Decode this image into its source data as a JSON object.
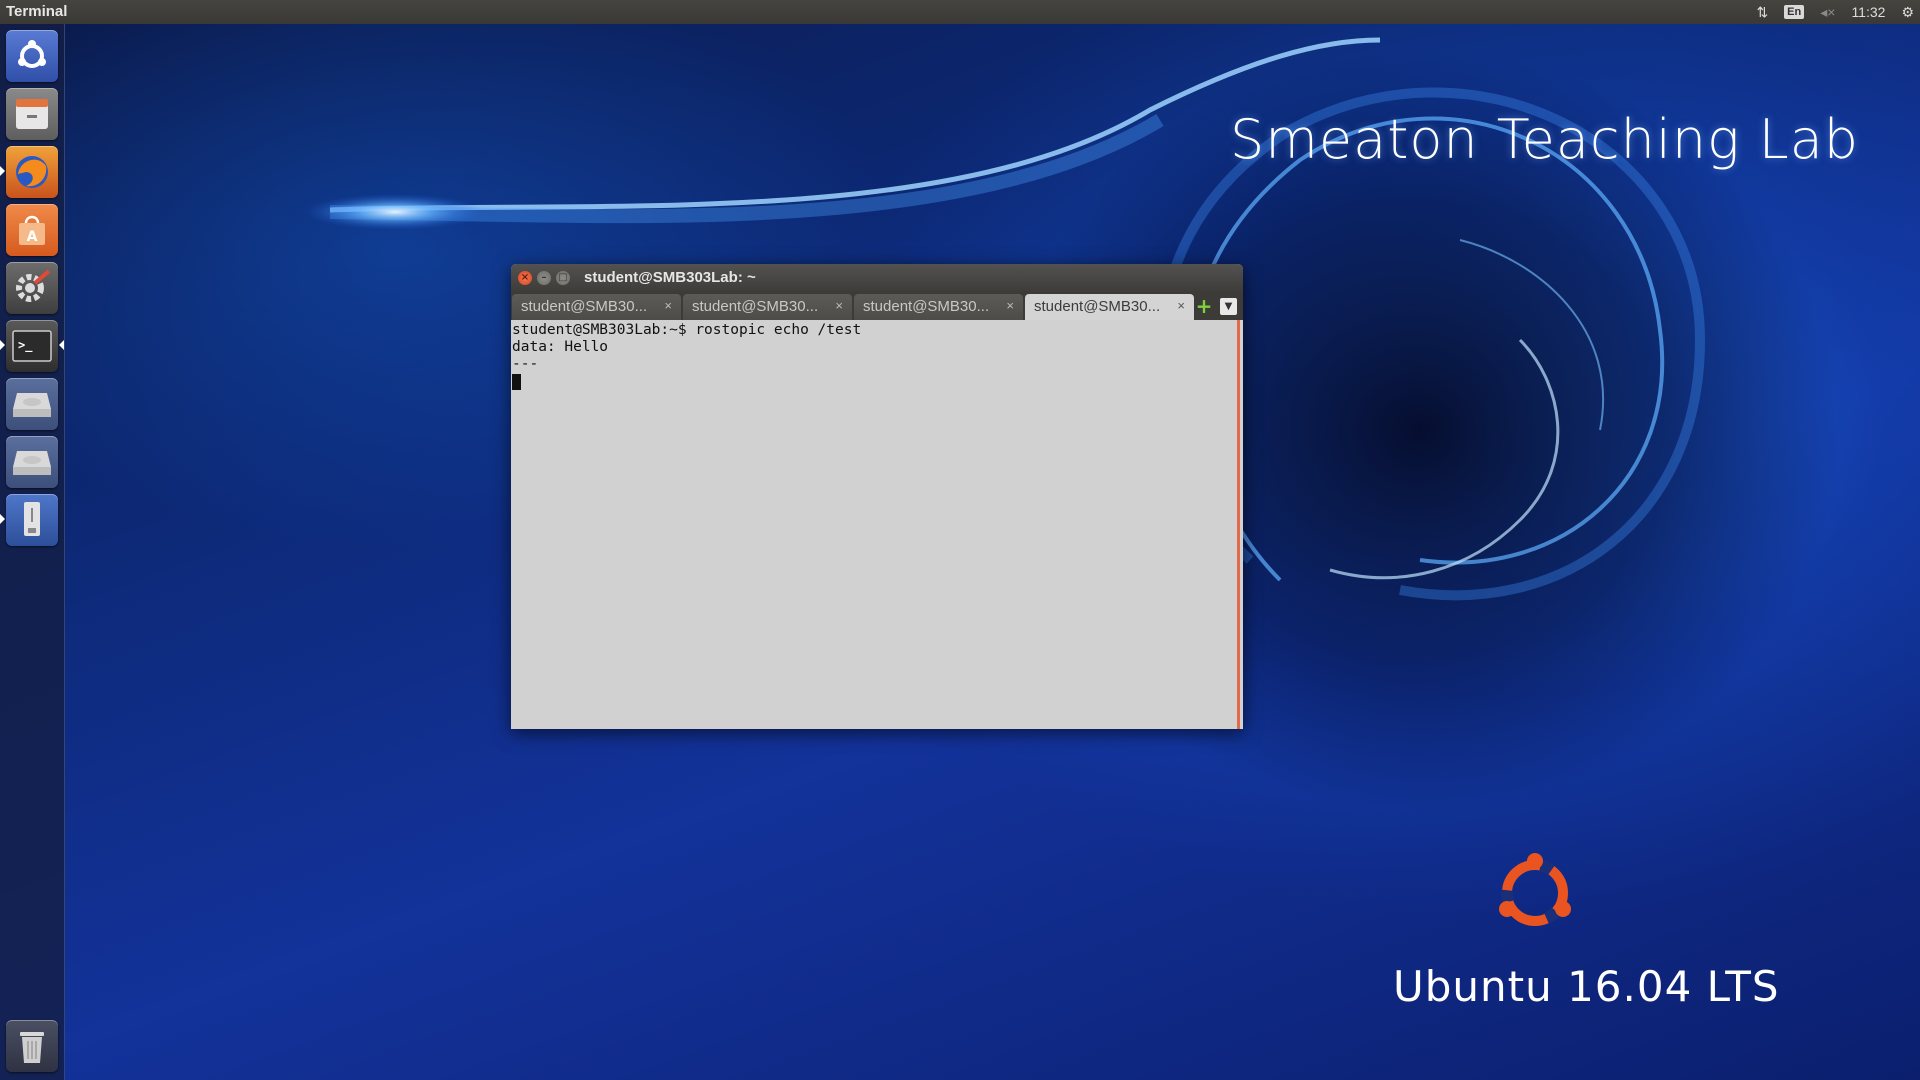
{
  "top_panel": {
    "app_title": "Terminal",
    "keyboard_layout": "En",
    "clock": "11:32",
    "icons": [
      "network-icon",
      "keyboard-icon",
      "volume-muted-icon",
      "settings-gear-icon"
    ]
  },
  "launcher": {
    "items": [
      {
        "name": "dash-home",
        "icon": "ubuntu-dash-icon"
      },
      {
        "name": "files",
        "icon": "file-cabinet-icon"
      },
      {
        "name": "firefox",
        "icon": "firefox-icon"
      },
      {
        "name": "software-center",
        "icon": "shopping-bag-icon"
      },
      {
        "name": "system-settings",
        "icon": "settings-tools-icon"
      },
      {
        "name": "terminal",
        "icon": "terminal-icon"
      },
      {
        "name": "disk-1",
        "icon": "hard-drive-icon"
      },
      {
        "name": "disk-2",
        "icon": "hard-drive-icon"
      },
      {
        "name": "usb",
        "icon": "usb-drive-icon"
      },
      {
        "name": "trash",
        "icon": "trash-icon"
      }
    ]
  },
  "desktop": {
    "lab_title": "Smeaton Teaching Lab",
    "os_version": "Ubuntu 16.04 LTS",
    "accent_color": "#e95420"
  },
  "terminal": {
    "window_title": "student@SMB303Lab: ~",
    "tabs": [
      {
        "label": "student@SMB30...",
        "active": false
      },
      {
        "label": "student@SMB30...",
        "active": false
      },
      {
        "label": "student@SMB30...",
        "active": false
      },
      {
        "label": "student@SMB30...",
        "active": true
      }
    ],
    "tab_close": "×",
    "lines": [
      "student@SMB303Lab:~$ rostopic echo /test",
      "data: Hello",
      "---"
    ]
  }
}
